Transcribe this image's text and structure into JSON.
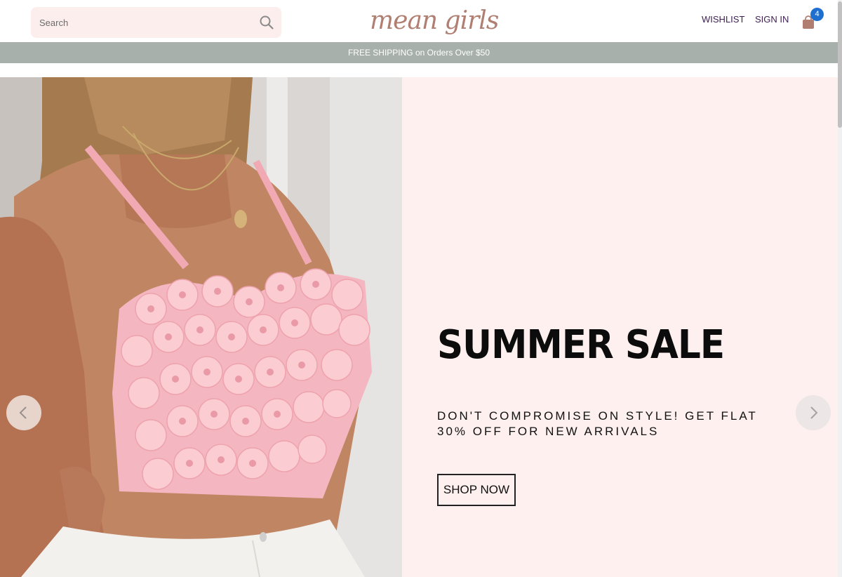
{
  "header": {
    "search_placeholder": "Search",
    "search_icon": "search-icon",
    "logo_text": "mean girls",
    "wishlist_label": "WISHLIST",
    "signin_label": "SIGN IN",
    "cart_icon": "shopping-bag-icon",
    "cart_count": "4"
  },
  "announcement": {
    "text": "FREE SHIPPING on Orders Over $50"
  },
  "hero": {
    "image_icon": "model-photo",
    "title": "SUMMER SALE",
    "subtitle": "DON'T COMPROMISE ON STYLE! GET FLAT 30% OFF FOR NEW ARRIVALS",
    "cta_label": "SHOP NOW",
    "prev_icon": "chevron-left-icon",
    "next_icon": "chevron-right-icon"
  },
  "colors": {
    "accent_logo": "#b07f72",
    "announcement_bg": "#a7b0aa",
    "hero_bg": "#fdf0ef",
    "search_bg": "#fdeeee",
    "cart_badge": "#1f6fd1",
    "nav_text": "#3d1f52"
  }
}
